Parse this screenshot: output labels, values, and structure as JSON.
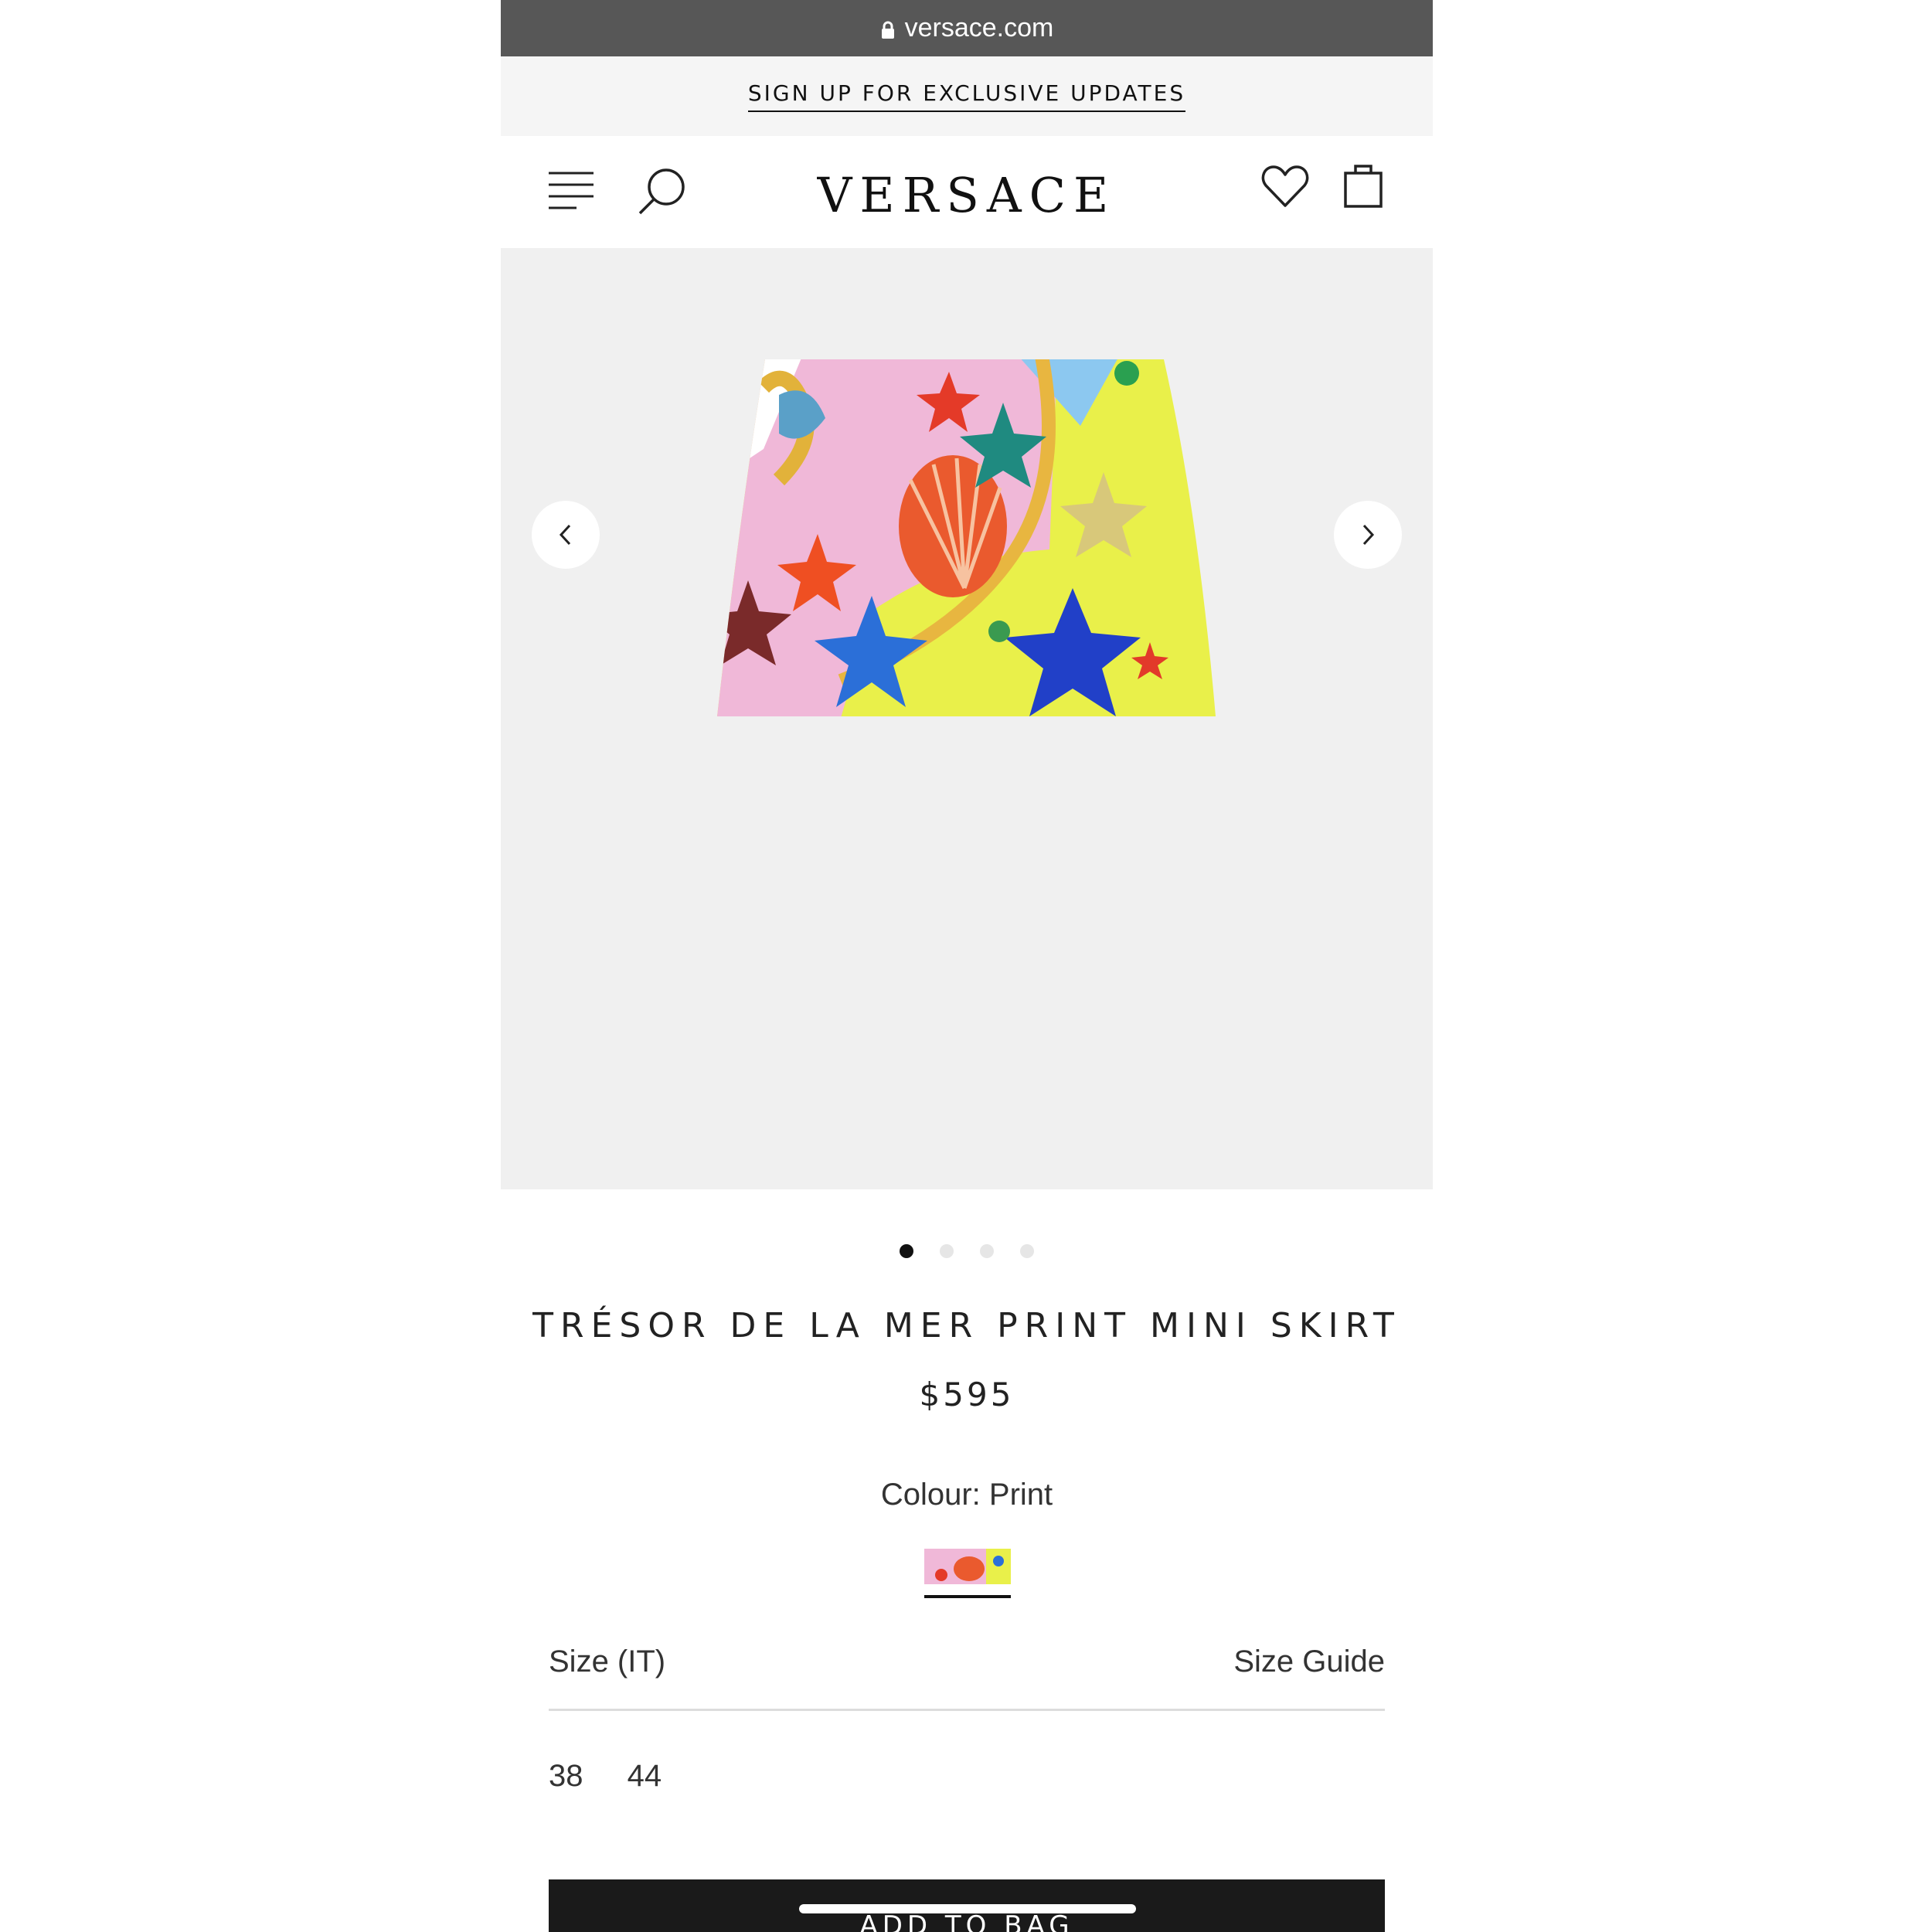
{
  "browser": {
    "url": "versace.com",
    "icon": "lock-icon"
  },
  "promo": {
    "signup_label": "SIGN UP FOR EXCLUSIVE UPDATES"
  },
  "header": {
    "logo": "VERSACE",
    "menu_icon": "hamburger-menu-icon",
    "search_icon": "search-icon",
    "wishlist_icon": "heart-icon",
    "bag_icon": "shopping-bag-icon"
  },
  "gallery": {
    "prev_icon": "chevron-left-icon",
    "next_icon": "chevron-right-icon",
    "image_count": 4,
    "active_index": 0
  },
  "product": {
    "title": "TRÉSOR DE LA MER PRINT MINI SKIRT",
    "price": "$595",
    "colour_label": "Colour: Print"
  },
  "size": {
    "label": "Size   (IT)",
    "guide_label": "Size Guide",
    "options": [
      "38",
      "44"
    ]
  },
  "cta": {
    "add_to_bag": "ADD TO BAG"
  },
  "colors": {
    "url_bar": "#575757",
    "promo_bg": "#f5f5f5",
    "gallery_bg": "#f0f0f0",
    "button_bg": "#1a1a1a"
  }
}
